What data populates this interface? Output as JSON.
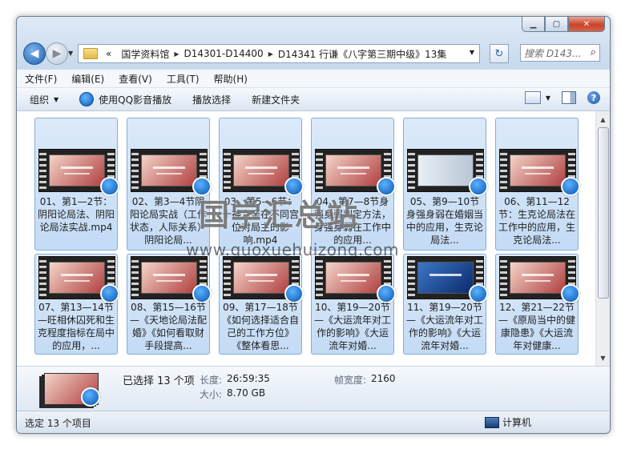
{
  "address": {
    "chevron": "«",
    "crumbs": [
      "国学资料馆",
      "D14301-D14400",
      "D14341 行谦《八字第三期中级》13集"
    ]
  },
  "search": {
    "placeholder": "搜索 D143..."
  },
  "menu": [
    "文件(F)",
    "编辑(E)",
    "查看(V)",
    "工具(T)",
    "帮助(H)"
  ],
  "toolbar": {
    "organize": "组织",
    "play_qq": "使用QQ影音播放",
    "play_selection": "播放选择",
    "new_folder": "新建文件夹"
  },
  "files": [
    {
      "name": "01、第1—2节：阴阳论局法、阴阳论局法实战.mp4",
      "thumb": "slide"
    },
    {
      "name": "02、第3—4节阴阳论局实战（工作状态，人际关系）阴阳论局...",
      "thumb": "slide"
    },
    {
      "name": "03、第5—6节：十神六亲在不同宫位对局主的影响.mp4",
      "thumb": "slide"
    },
    {
      "name": "04、第7—8节身强身弱判定方法，身强身弱在工作中的应用...",
      "thumb": "slide"
    },
    {
      "name": "05、第9—10节 身强身弱在婚姻当中的应用，生克论局法...",
      "thumb": "person"
    },
    {
      "name": "06、第11—12节：生克论局法在工作中的应用，生克论局法...",
      "thumb": "slide"
    },
    {
      "name": "07、第13—14节—旺相休囚死和生克程度指标在局中的应用，...",
      "thumb": "slide"
    },
    {
      "name": "08、第15—16节—《天地论局法配婚》《如何看取财手段提高...",
      "thumb": "slide"
    },
    {
      "name": "09、第17—18节《如何选择适合自己的工作方位》《整体看思...",
      "thumb": "slide"
    },
    {
      "name": "10、第19—20节—《大运流年对工作的影响》《大运流年对婚...",
      "thumb": "slide"
    },
    {
      "name": "11、第19—20节—《大运流年对工作的影响》《大运流年对婚...",
      "thumb": "blue"
    },
    {
      "name": "12、第21—22节—《原局当中的健康隐患》《大运流年对健康...",
      "thumb": "slide"
    }
  ],
  "details": {
    "selected": "已选择 13 个项",
    "length_label": "长度:",
    "length_value": "26:59:35",
    "size_label": "大小:",
    "size_value": "8.70 GB",
    "framewidth_label": "帧宽度:",
    "framewidth_value": "2160"
  },
  "status": {
    "left": "选定 13 个项目",
    "computer": "计算机"
  },
  "watermark": {
    "text": "国学汇总站",
    "url": "www.guoxuehuizong.com"
  },
  "colors": {
    "selection_fill": "#c4dbf5",
    "selection_border": "#84acdd",
    "accent": "#0a55b0"
  }
}
